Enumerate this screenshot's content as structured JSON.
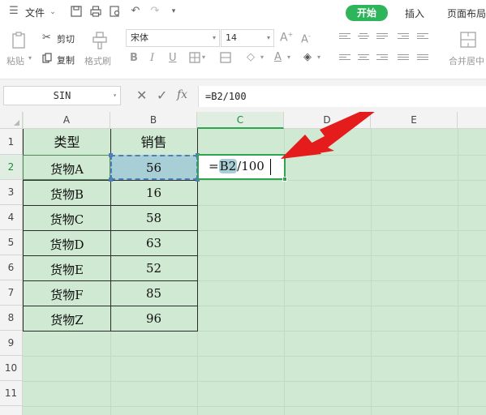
{
  "menu": {
    "file_label": "文件",
    "tabs": [
      {
        "label": "开始",
        "active": true
      },
      {
        "label": "插入",
        "active": false
      },
      {
        "label": "页面布局",
        "active": false
      }
    ],
    "accent_color": "#2eb45a"
  },
  "ribbon": {
    "paste_label": "粘贴",
    "cut_label": "剪切",
    "copy_label": "复制",
    "format_painter_label": "格式刷",
    "font_name": "宋体",
    "font_size": "14",
    "merge_center_label": "合并居中"
  },
  "formula_bar": {
    "name_box": "SIN",
    "formula": "=B2/100"
  },
  "sheet": {
    "columns": [
      "A",
      "B",
      "C",
      "D",
      "E"
    ],
    "rows": [
      "1",
      "2",
      "3",
      "4",
      "5",
      "6",
      "7",
      "8",
      "9",
      "10",
      "11"
    ],
    "header": {
      "type": "类型",
      "sales": "销售"
    },
    "data": [
      {
        "type": "货物A",
        "sales": "56"
      },
      {
        "type": "货物B",
        "sales": "16"
      },
      {
        "type": "货物C",
        "sales": "58"
      },
      {
        "type": "货物D",
        "sales": "63"
      },
      {
        "type": "货物E",
        "sales": "52"
      },
      {
        "type": "货物F",
        "sales": "85"
      },
      {
        "type": "货物Z",
        "sales": "96"
      }
    ],
    "editing_cell": {
      "prefix": "=",
      "ref": "B2",
      "suffix": "/100"
    },
    "sheet_color": "#cfe9d2"
  }
}
